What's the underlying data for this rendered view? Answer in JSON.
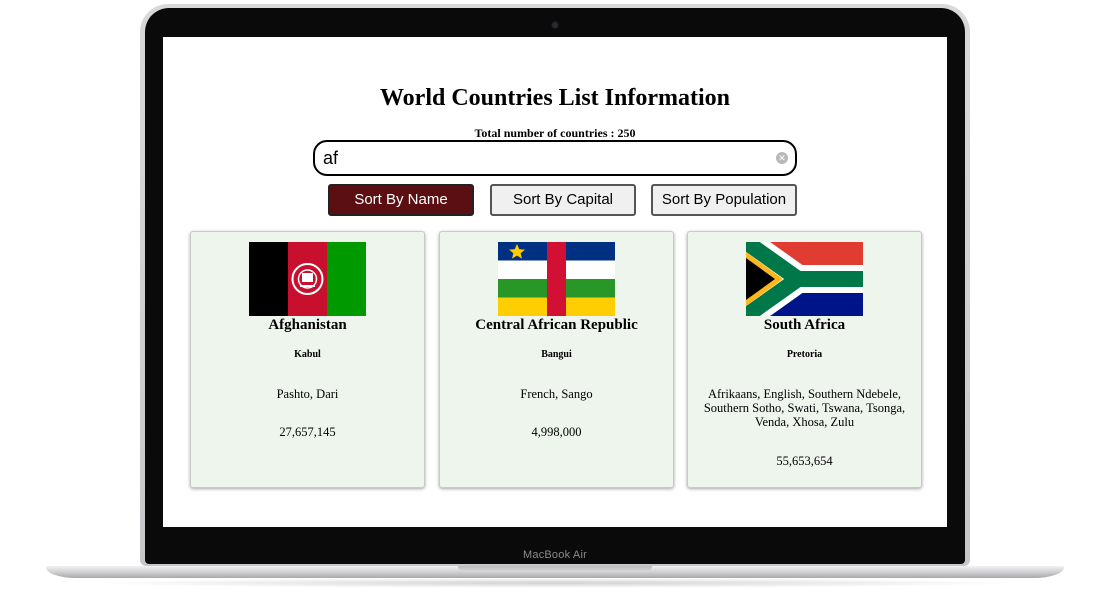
{
  "device": {
    "label": "MacBook Air"
  },
  "page": {
    "title": "World Countries List Information",
    "total_text": "Total number of countries : 250"
  },
  "search": {
    "value": "af",
    "clear_icon": "clear-icon"
  },
  "sort_buttons": [
    {
      "label": "Sort By Name",
      "active": true
    },
    {
      "label": "Sort By Capital",
      "active": false
    },
    {
      "label": "Sort By Population",
      "active": false
    }
  ],
  "colors": {
    "active_button": "#5b0f12",
    "card_bg": "#eef5ed"
  },
  "countries": [
    {
      "name": "Afghanistan",
      "capital": "Kabul",
      "languages": "Pashto, Dari",
      "population": "27,657,145"
    },
    {
      "name": "Central African Republic",
      "capital": "Bangui",
      "languages": "French, Sango",
      "population": "4,998,000"
    },
    {
      "name": "South Africa",
      "capital": "Pretoria",
      "languages": "Afrikaans, English, Southern Ndebele, Southern Sotho, Swati, Tswana, Tsonga, Venda, Xhosa, Zulu",
      "population": "55,653,654"
    }
  ]
}
